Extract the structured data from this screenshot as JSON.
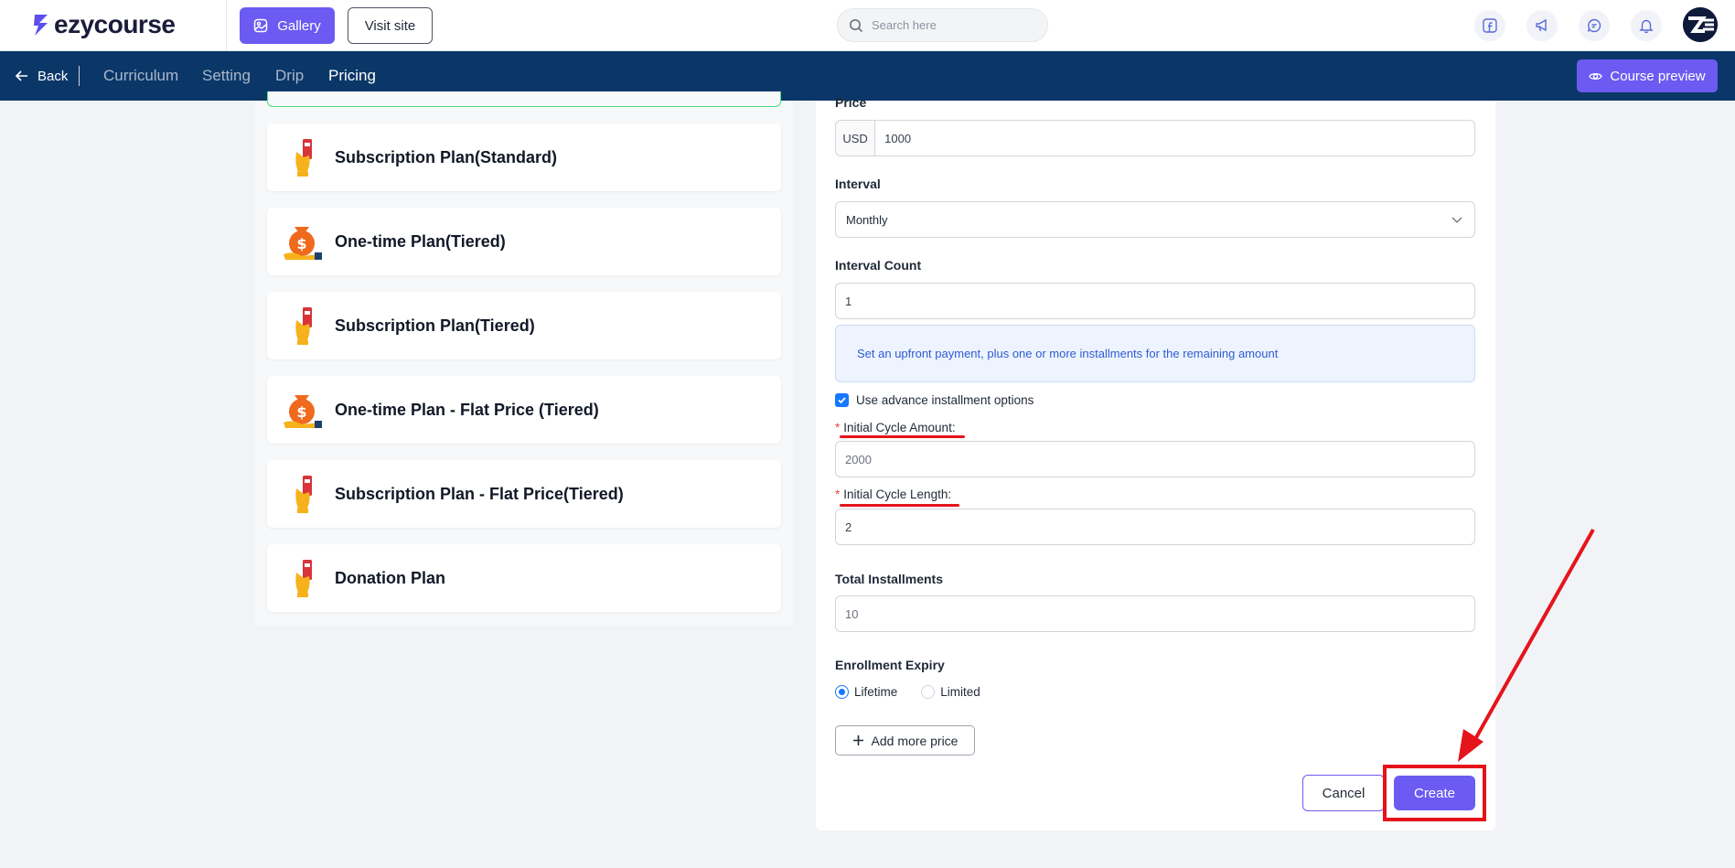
{
  "brand": {
    "name": "ezycourse"
  },
  "topbar": {
    "gallery_label": "Gallery",
    "visit_site_label": "Visit site",
    "search_placeholder": "Search here",
    "icons": [
      "facebook-icon",
      "megaphone-icon",
      "chat-icon",
      "bell-icon"
    ]
  },
  "nav": {
    "back_label": "Back",
    "tabs": [
      {
        "label": "Curriculum",
        "active": false
      },
      {
        "label": "Setting",
        "active": false
      },
      {
        "label": "Drip",
        "active": false
      },
      {
        "label": "Pricing",
        "active": true
      }
    ],
    "preview_label": "Course preview"
  },
  "plans": [
    {
      "title": "Subscription Plan(Standard)",
      "icon": "card-hand-icon"
    },
    {
      "title": "One-time Plan(Tiered)",
      "icon": "money-bag-icon"
    },
    {
      "title": "Subscription Plan(Tiered)",
      "icon": "card-hand-icon"
    },
    {
      "title": "One-time Plan - Flat Price (Tiered)",
      "icon": "money-bag-icon"
    },
    {
      "title": "Subscription Plan - Flat Price(Tiered)",
      "icon": "card-hand-icon"
    },
    {
      "title": "Donation Plan",
      "icon": "card-hand-icon"
    }
  ],
  "form": {
    "price_label": "Price",
    "currency": "USD",
    "price_value": "1000",
    "interval_label": "Interval",
    "interval_value": "Monthly",
    "interval_count_label": "Interval Count",
    "interval_count_value": "1",
    "info_text": "Set an upfront payment, plus one or more installments for the remaining amount",
    "advance_option_label": "Use advance installment options",
    "advance_option_checked": true,
    "initial_amount_label": "Initial Cycle Amount",
    "initial_amount_placeholder": "2000",
    "initial_length_label": "Initial Cycle Length",
    "initial_length_value": "2",
    "total_installments_label": "Total Installments",
    "total_installments_placeholder": "10",
    "expiry_label": "Enrollment Expiry",
    "expiry_options": [
      {
        "label": "Lifetime",
        "selected": true
      },
      {
        "label": "Limited",
        "selected": false
      }
    ],
    "add_price_label": "Add more price",
    "cancel_label": "Cancel",
    "create_label": "Create"
  },
  "annotation_color": "#e5141b",
  "accent_color": "#6b5bf2"
}
